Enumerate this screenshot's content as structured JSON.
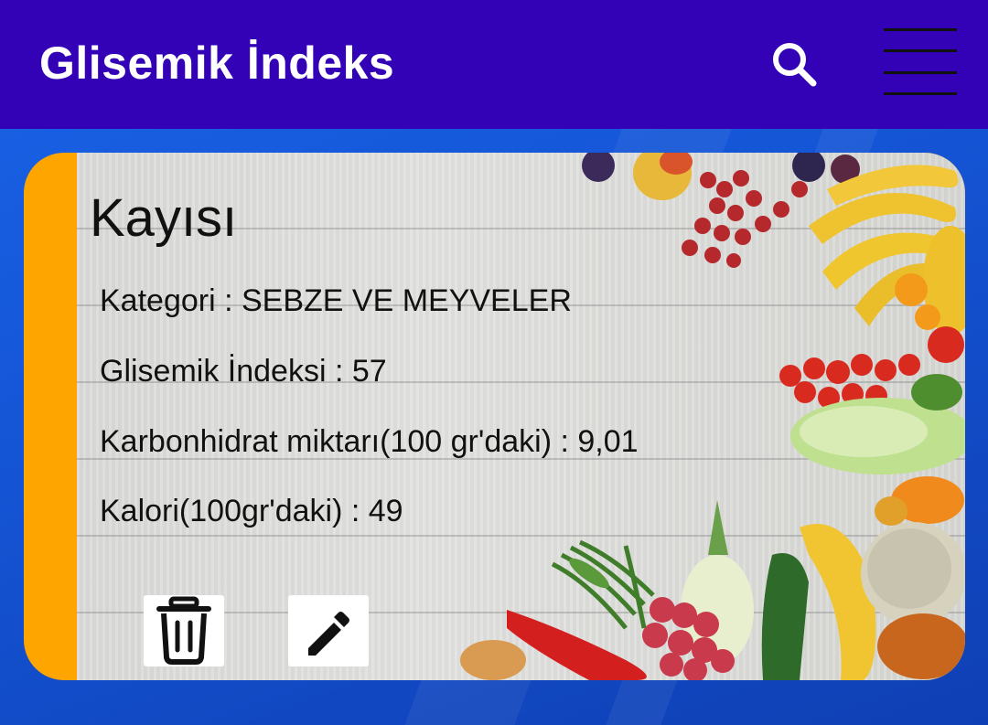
{
  "app_bar": {
    "title": "Glisemik İndeks",
    "color": "#3302b6"
  },
  "card": {
    "accent_color": "#ffa500",
    "title": "Kayısı",
    "lines": [
      "Kategori : SEBZE VE MEYVELER",
      "Glisemik İndeksi : 57",
      "Karbonhidrat miktarı(100 gr'daki) : 9,01",
      "Kalori(100gr'daki) : 49"
    ]
  },
  "icons": {
    "search": "search-icon",
    "menu": "hamburger-menu-icon",
    "delete": "trash-icon",
    "edit": "pencil-icon"
  }
}
